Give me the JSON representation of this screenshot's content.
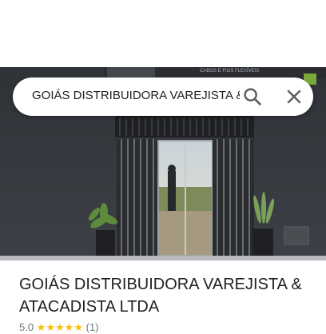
{
  "search": {
    "query": "GOIÁS DISTRIBUIDORA VAREJISTA & ATACADISTA LTDA"
  },
  "place": {
    "name": "GOIÁS DISTRIBUIDORA VAREJISTA & ATACADISTA LTDA",
    "rating": "5.0",
    "stars": 5,
    "review_count": "(1)",
    "photo_sign_text": "CABOS E FIOS FLEXÍVEIS"
  },
  "colors": {
    "star": "#fbbc04",
    "title": "#202124",
    "icon": "#5f6368"
  },
  "icons": [
    "search-icon",
    "close-icon",
    "star-icon"
  ]
}
